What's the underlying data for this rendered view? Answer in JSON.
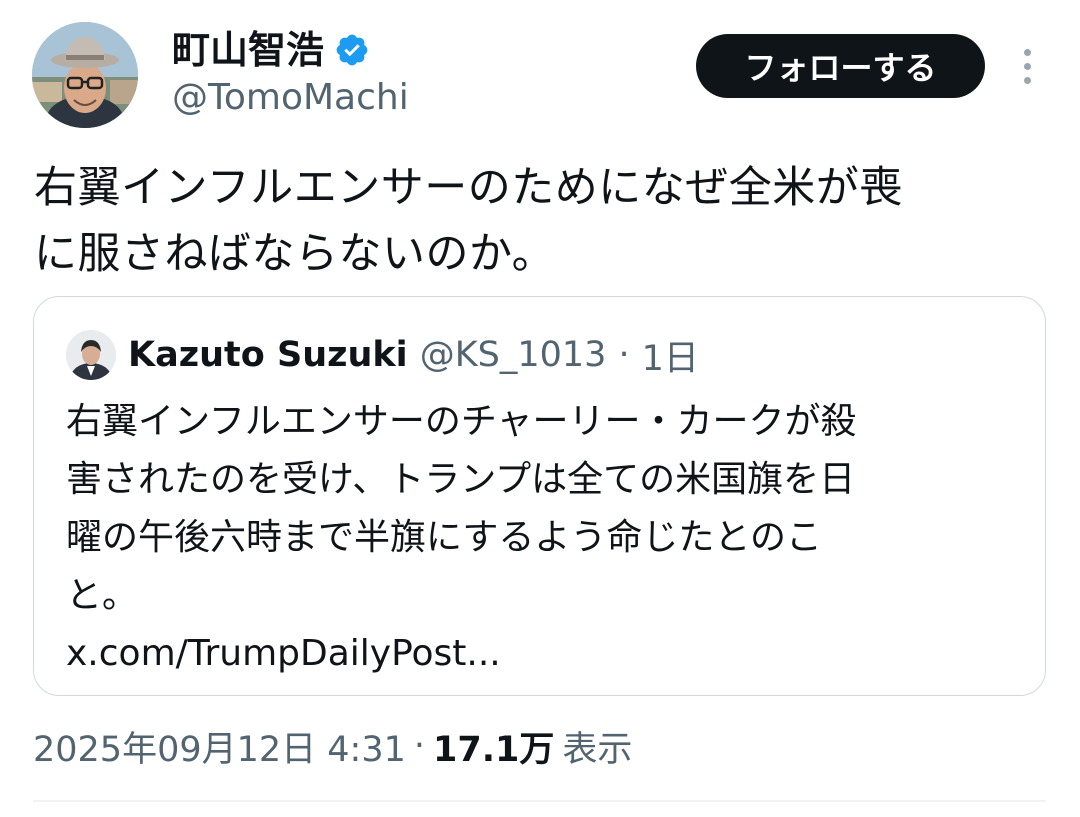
{
  "author": {
    "display_name": "町山智浩",
    "handle": "@TomoMachi",
    "verified": true,
    "avatar_icon": "profile-photo-man-with-hat-and-glasses"
  },
  "actions": {
    "follow_label": "フォローする",
    "more_icon": "more-vertical-icon"
  },
  "tweet": {
    "text_line1": "右翼インフルエンサーのためになぜ全米が喪",
    "text_line2": "に服さねばならないのか。"
  },
  "quote": {
    "display_name": "Kazuto Suzuki",
    "handle": "@KS_1013",
    "separator": "·",
    "time": "1日",
    "text_line1": "右翼インフルエンサーのチャーリー・カークが殺",
    "text_line2": "害されたのを受け、トランプは全ての米国旗を日",
    "text_line3": "曜の午後六時まで半旗にするよう命じたとのこ",
    "text_line4": "と。",
    "link": "x.com/TrumpDailyPost..."
  },
  "meta": {
    "timestamp": "2025年09月12日 4:31",
    "separator": "·",
    "views_count": "17.1万",
    "views_label": "表示"
  },
  "colors": {
    "text_primary": "#0f1419",
    "text_secondary": "#536471",
    "verified_blue": "#1d9bf0",
    "follow_button_bg": "#0f1419",
    "border": "#cfd9de"
  }
}
